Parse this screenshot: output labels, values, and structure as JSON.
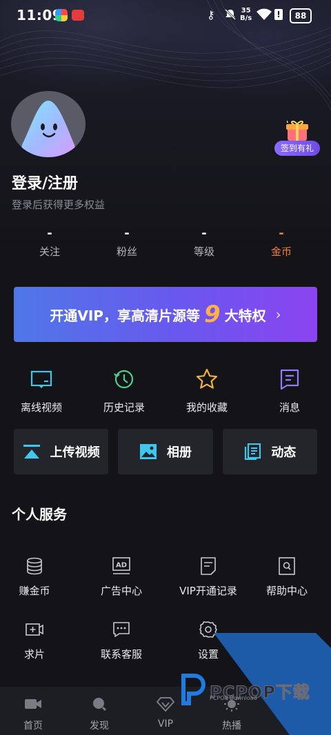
{
  "status_bar": {
    "time": "11:09",
    "net_speed_value": "35",
    "net_speed_unit": "B/s",
    "battery": "88"
  },
  "profile": {
    "title": "登录/注册",
    "subtitle": "登录后获得更多权益",
    "gift_badge": "签到有礼"
  },
  "stats": [
    {
      "value": "-",
      "label": "关注"
    },
    {
      "value": "-",
      "label": "粉丝"
    },
    {
      "value": "-",
      "label": "等级"
    },
    {
      "value": "-",
      "label": "金币"
    }
  ],
  "vip_banner": {
    "text_before": "开通VIP，享高清片源等",
    "number": "9",
    "text_after": "大特权",
    "arrow": "›"
  },
  "quick_actions": [
    {
      "label": "离线视频",
      "icon": "offline-video-icon"
    },
    {
      "label": "历史记录",
      "icon": "history-icon"
    },
    {
      "label": "我的收藏",
      "icon": "star-icon"
    },
    {
      "label": "消息",
      "icon": "message-icon"
    }
  ],
  "cards": [
    {
      "label": "上传视频",
      "icon": "upload-icon"
    },
    {
      "label": "相册",
      "icon": "album-icon"
    },
    {
      "label": "动态",
      "icon": "feed-icon"
    }
  ],
  "section_title": "个人服务",
  "services": [
    {
      "label": "赚金币",
      "icon": "coins-icon"
    },
    {
      "label": "广告中心",
      "icon": "ad-icon"
    },
    {
      "label": "VIP开通记录",
      "icon": "vip-record-icon"
    },
    {
      "label": "帮助中心",
      "icon": "help-icon"
    },
    {
      "label": "求片",
      "icon": "request-video-icon"
    },
    {
      "label": "联系客服",
      "icon": "customer-service-icon"
    },
    {
      "label": "设置",
      "icon": "gear-icon"
    }
  ],
  "watermark": {
    "brand": "PCPOP下载",
    "sub": "PCPOP Download"
  },
  "bottom_nav": [
    {
      "label": "首页",
      "icon": "camera-icon"
    },
    {
      "label": "发现",
      "icon": "search-icon"
    },
    {
      "label": "VIP",
      "icon": "vip-diamond-icon"
    },
    {
      "label": "热播",
      "icon": "sun-icon"
    }
  ],
  "colors": {
    "background": "#141418",
    "accent_orange": "#f0813b",
    "accent_cyan": "#3ec8f0",
    "vip_gradient_start": "#4f77e8",
    "vip_gradient_end": "#8b44f0"
  }
}
